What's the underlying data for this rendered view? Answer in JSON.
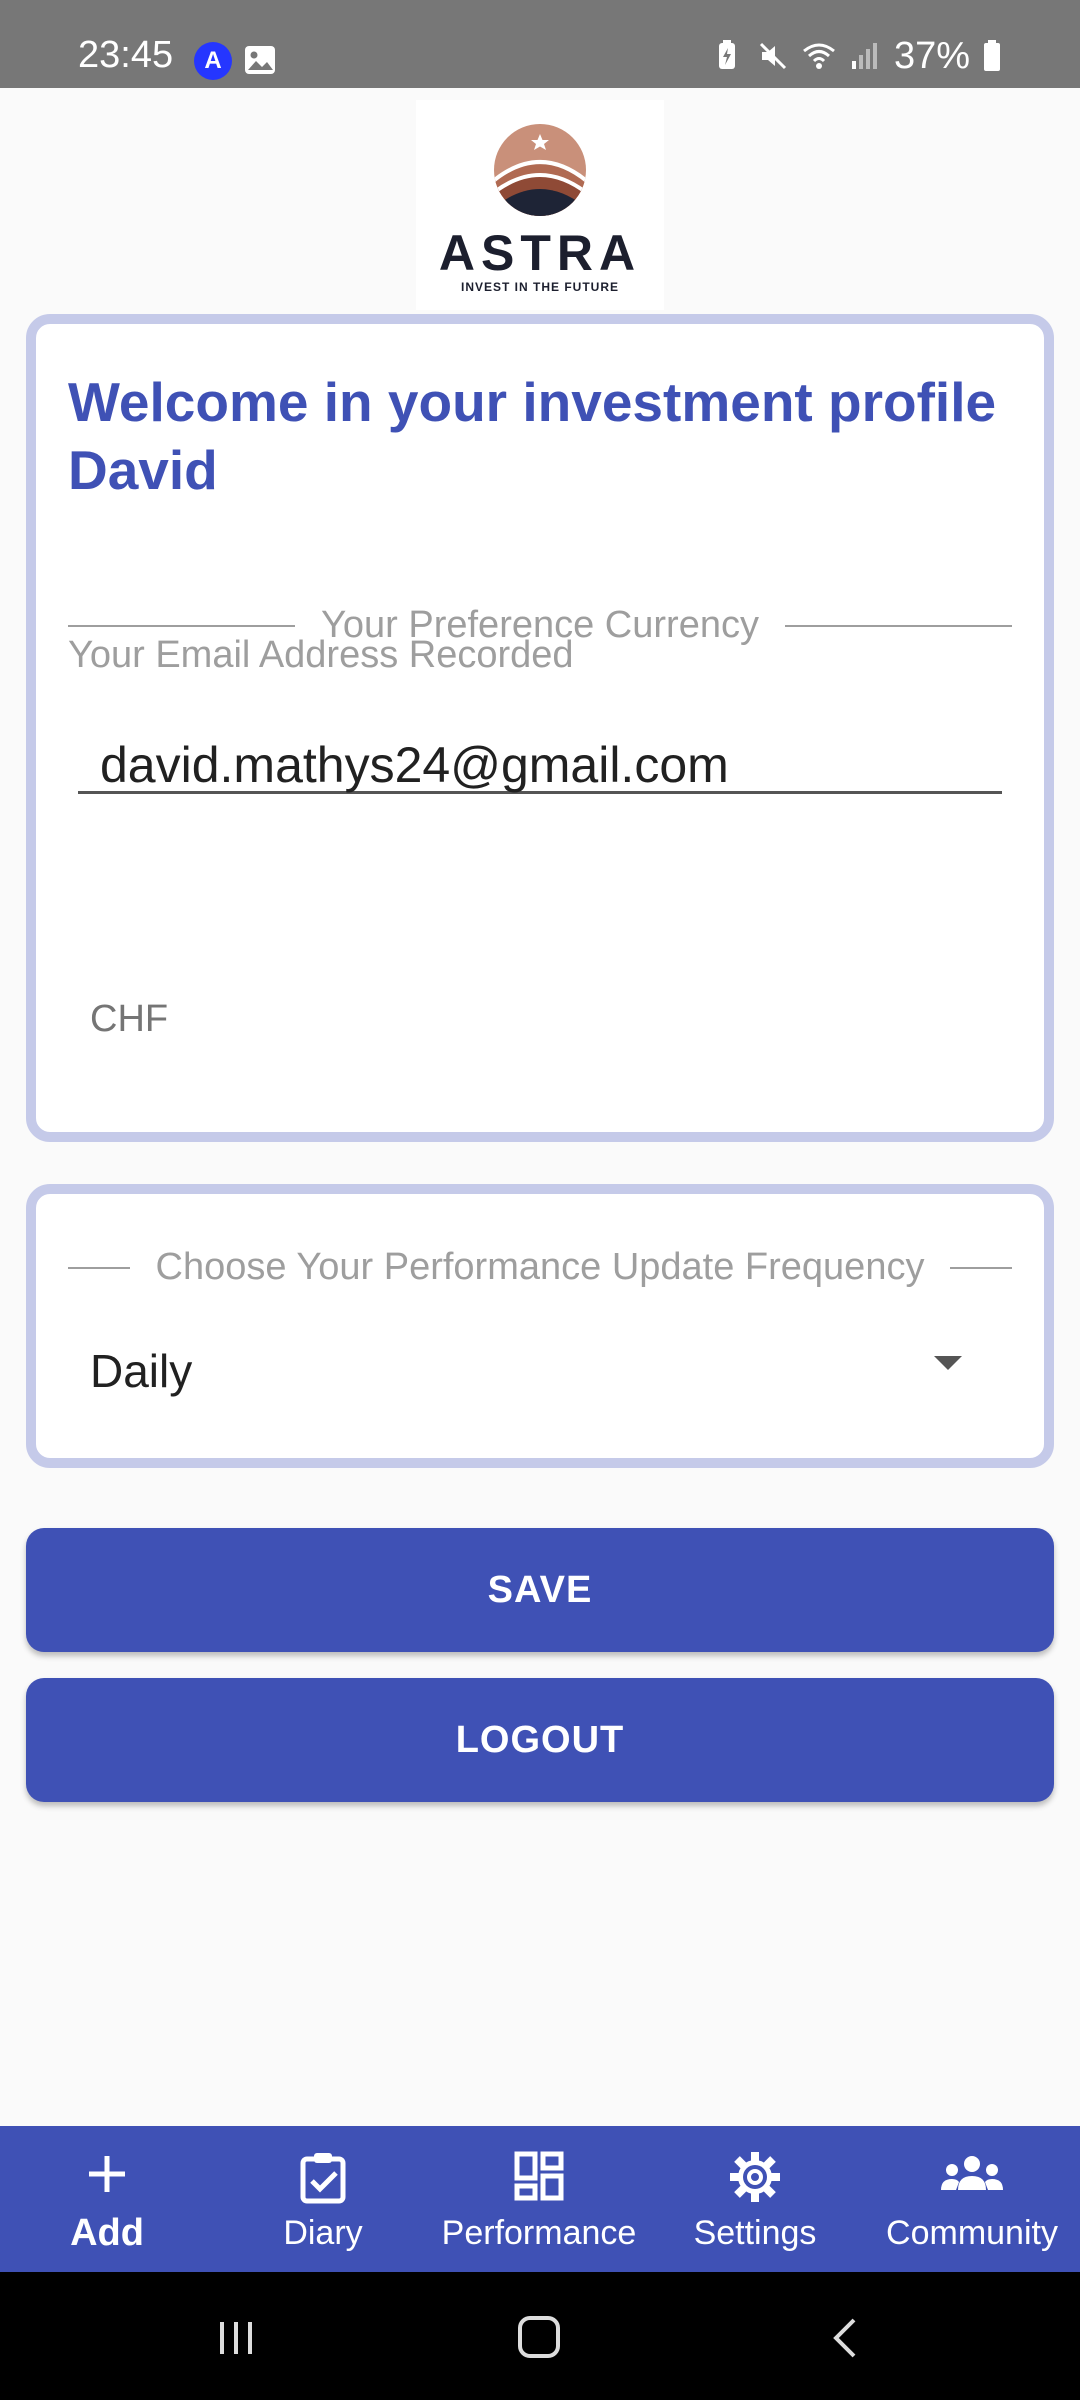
{
  "status_bar": {
    "time": "23:45",
    "badge": "A",
    "battery": "37%",
    "icons": [
      "gallery-icon",
      "battery-saver-icon",
      "mute-icon",
      "wifi-icon",
      "signal-icon",
      "battery-icon"
    ]
  },
  "logo": {
    "name": "ASTRA",
    "tagline": "INVEST IN THE FUTURE"
  },
  "profile": {
    "welcome": "Welcome in your investment profile David",
    "email_label": "Your Email Address Recorded",
    "email_value": "david.mathys24@gmail.com",
    "currency_label": "Your Preference Currency",
    "currency_value": "CHF"
  },
  "frequency": {
    "label": "Choose Your Performance Update Frequency",
    "selected": "Daily"
  },
  "buttons": {
    "save": "SAVE",
    "logout": "LOGOUT"
  },
  "bottom_nav": {
    "items": [
      {
        "label": "Add",
        "icon": "plus-icon"
      },
      {
        "label": "Diary",
        "icon": "clipboard-check-icon"
      },
      {
        "label": "Performance",
        "icon": "dashboard-icon"
      },
      {
        "label": "Settings",
        "icon": "gear-icon"
      },
      {
        "label": "Community",
        "icon": "group-icon"
      }
    ]
  },
  "colors": {
    "primary": "#3f51b5",
    "card_border": "#c5cae9",
    "status_bar": "#777777"
  }
}
